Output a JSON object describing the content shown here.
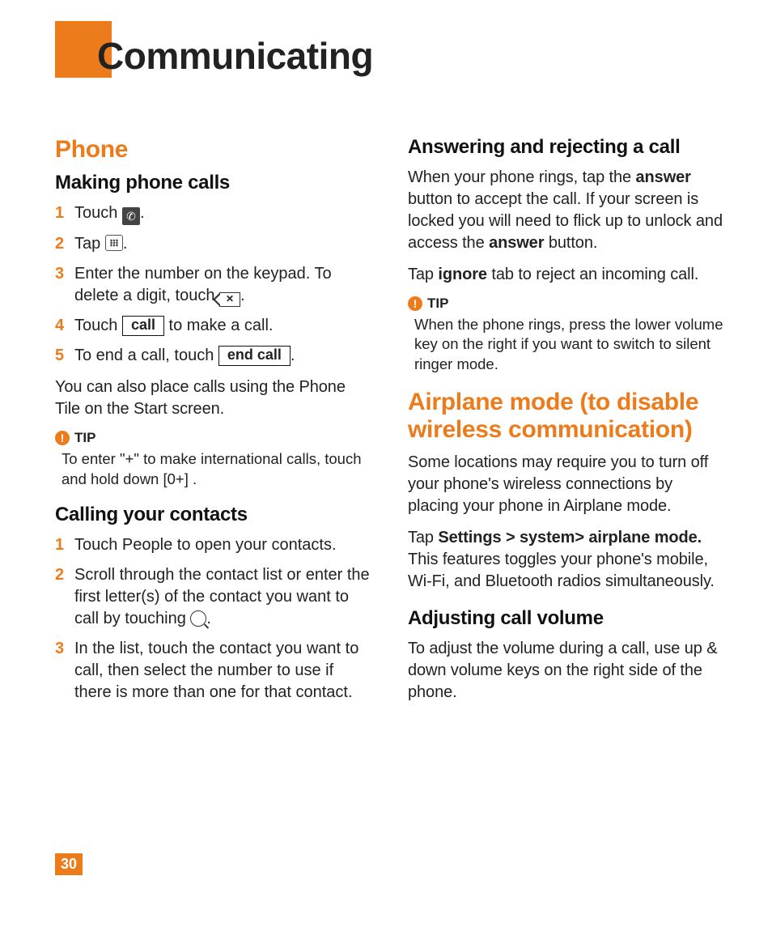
{
  "pageTitle": "Communicating",
  "pageNumber": "30",
  "left": {
    "h_phone": "Phone",
    "h_making": "Making phone calls",
    "steps_making": {
      "s1a": "Touch ",
      "s1b": ".",
      "s2a": "Tap ",
      "s2b": ".",
      "s3": "Enter the number on the keypad. To delete a digit, touch  ",
      "s3b": ".",
      "s4a": "Touch ",
      "s4btn": "call",
      "s4b": " to make a call.",
      "s5a": "To end a call, touch ",
      "s5btn": "end call",
      "s5b": "."
    },
    "p_also": "You can also place calls using the Phone Tile on the Start screen.",
    "tip1_label": "TIP",
    "tip1_body": "To enter \"+\" to make international calls, touch and hold down [0+] .",
    "h_calling": "Calling your contacts",
    "steps_calling": {
      "s1": "Touch People to open your contacts.",
      "s2a": "Scroll through the contact list or enter the first letter(s) of the contact you want to call by touching ",
      "s2b": ".",
      "s3": "In the list, touch the contact you want to call, then select the number to use if there is more than one for that contact."
    }
  },
  "right": {
    "h_answer": "Answering and rejecting a call",
    "p_answer_a": "When your phone rings, tap the ",
    "p_answer_b": "answer",
    "p_answer_c": " button to accept the call.  If your screen is locked you will need to flick up to unlock and access the ",
    "p_answer_d": "answer",
    "p_answer_e": " button.",
    "p_ignore_a": "Tap ",
    "p_ignore_b": "ignore",
    "p_ignore_c": " tab to reject an incoming call.",
    "tip2_label": "TIP",
    "tip2_body": "When the phone rings, press the lower volume key on the right if you want to switch to silent ringer mode.",
    "h_airplane": "Airplane mode (to disable wireless communication)",
    "p_air1": "Some locations may require you to turn off your phone's wireless connections by placing your phone in Airplane mode.",
    "p_air2_a": "Tap ",
    "p_air2_b": "Settings > system> airplane mode.",
    "p_air2_c": " This features toggles your phone's mobile, Wi‑Fi, and Bluetooth radios simultaneously.",
    "h_adjust": "Adjusting call volume",
    "p_adjust": "To adjust the volume during a call, use up & down volume keys on the right side of the phone."
  }
}
